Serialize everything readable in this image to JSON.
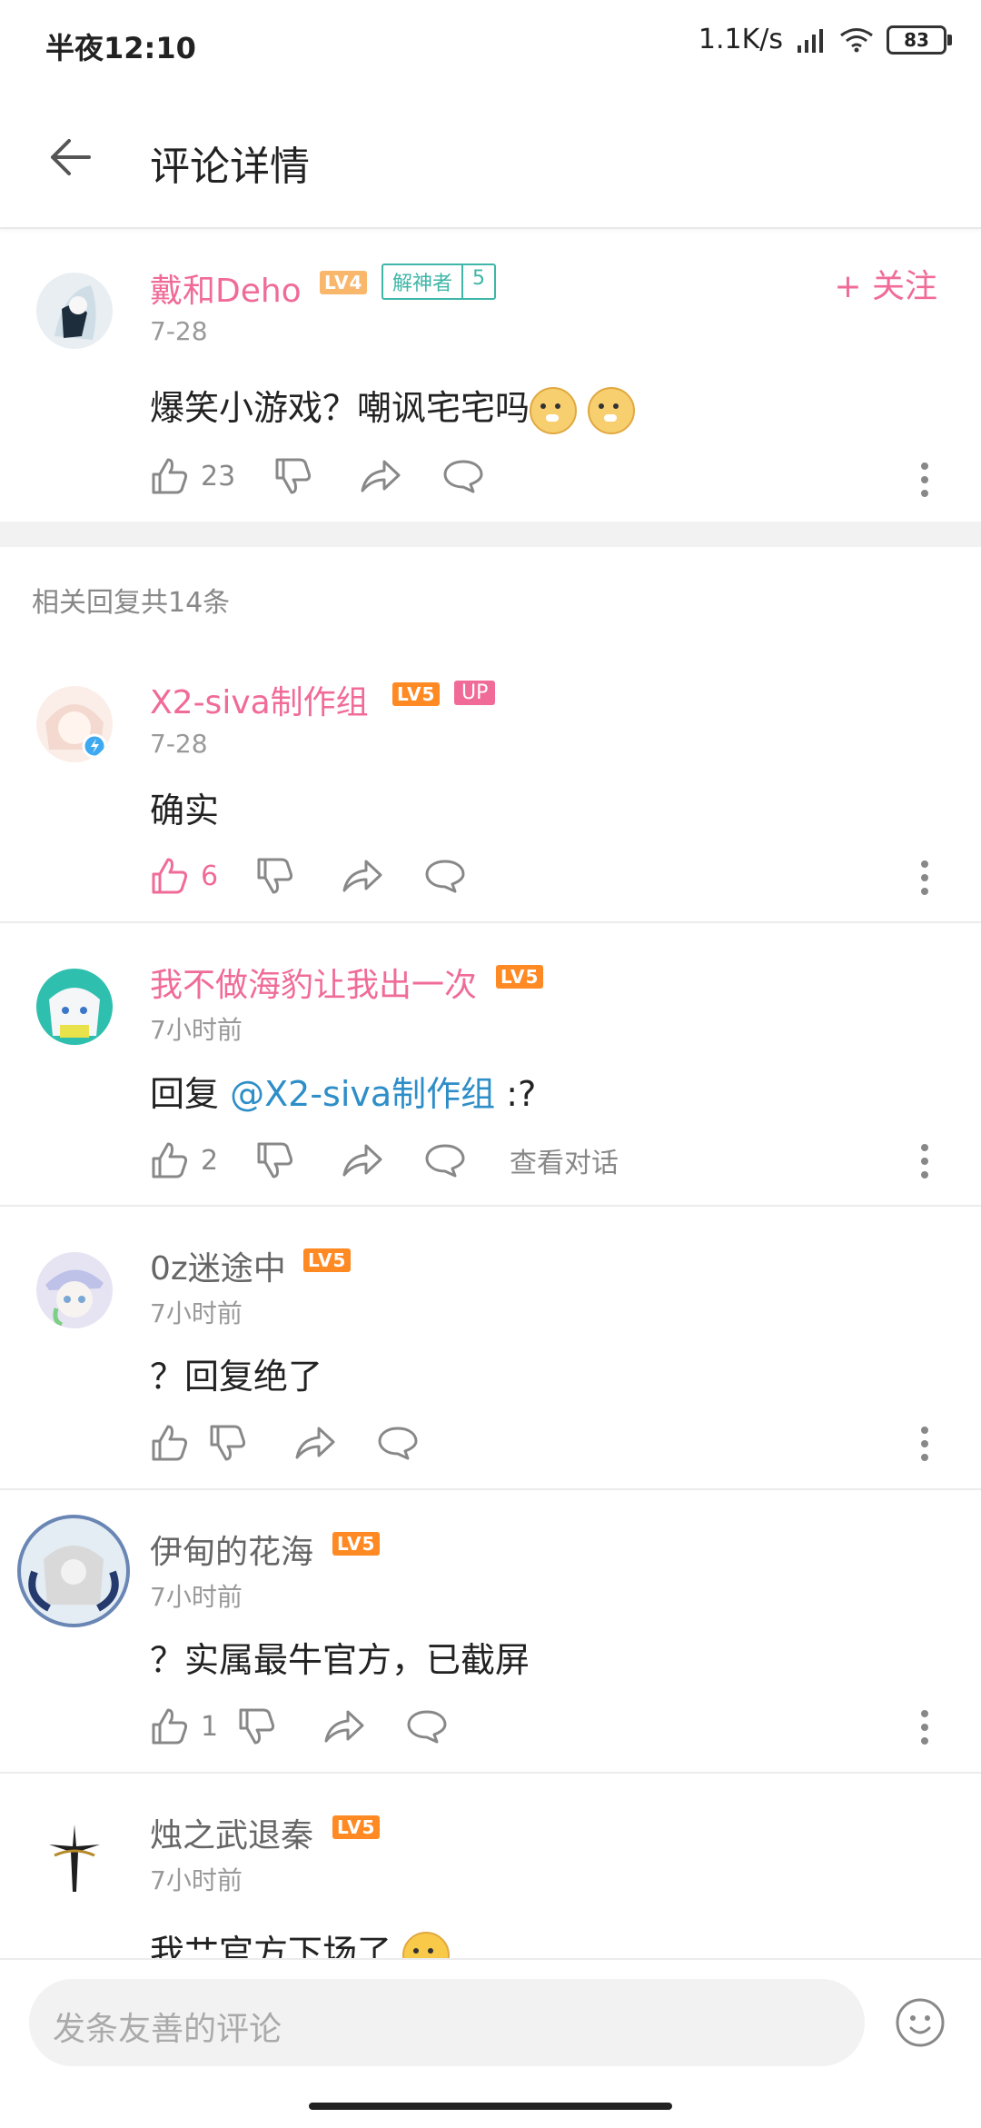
{
  "status_bar": {
    "time": "半夜12:10",
    "network": "1.1K/s",
    "battery": "83"
  },
  "header": {
    "title": "评论详情"
  },
  "main_comment": {
    "username": "戴和Deho",
    "level": "LV4",
    "badge_label": "解神者",
    "badge_count": "5",
    "follow_label": "+ 关注",
    "date": "7-28",
    "text": "爆笑小游戏？嘲讽宅宅吗",
    "emojis": [
      "doge-emoji",
      "doge-emoji"
    ],
    "likes": "23"
  },
  "replies_header": "相关回复共14条",
  "replies": [
    {
      "username": "X2-siva制作组",
      "level": "LV5",
      "badge": "UP",
      "date": "7-28",
      "text": "确实",
      "likes": "6",
      "name_color": "#f06b98",
      "liked": true
    },
    {
      "username": "我不做海豹让我出一次",
      "level": "LV5",
      "date": "7小时前",
      "reply_prefix": "回复",
      "mention": "@X2-siva制作组",
      "text_suffix": ":?",
      "likes": "2",
      "view_conversation": "查看对话",
      "name_color": "#f06b98"
    },
    {
      "username": "0z迷途中",
      "level": "LV5",
      "date": "7小时前",
      "text": "？回复绝了",
      "likes": ""
    },
    {
      "username": "伊甸的花海",
      "level": "LV5",
      "date": "7小时前",
      "text": "？实属最牛官方，已截屏",
      "likes": "1"
    },
    {
      "username": "烛之武退秦",
      "level": "LV5",
      "date": "7小时前",
      "text": "我艹官方下场了"
    }
  ],
  "bottom": {
    "input_placeholder": "发条友善的评论"
  },
  "colors": {
    "accent": "#f06b98",
    "link": "#2e8ec8",
    "badge_teal": "#3fb6a8",
    "level_orange": "#ff8a24"
  }
}
